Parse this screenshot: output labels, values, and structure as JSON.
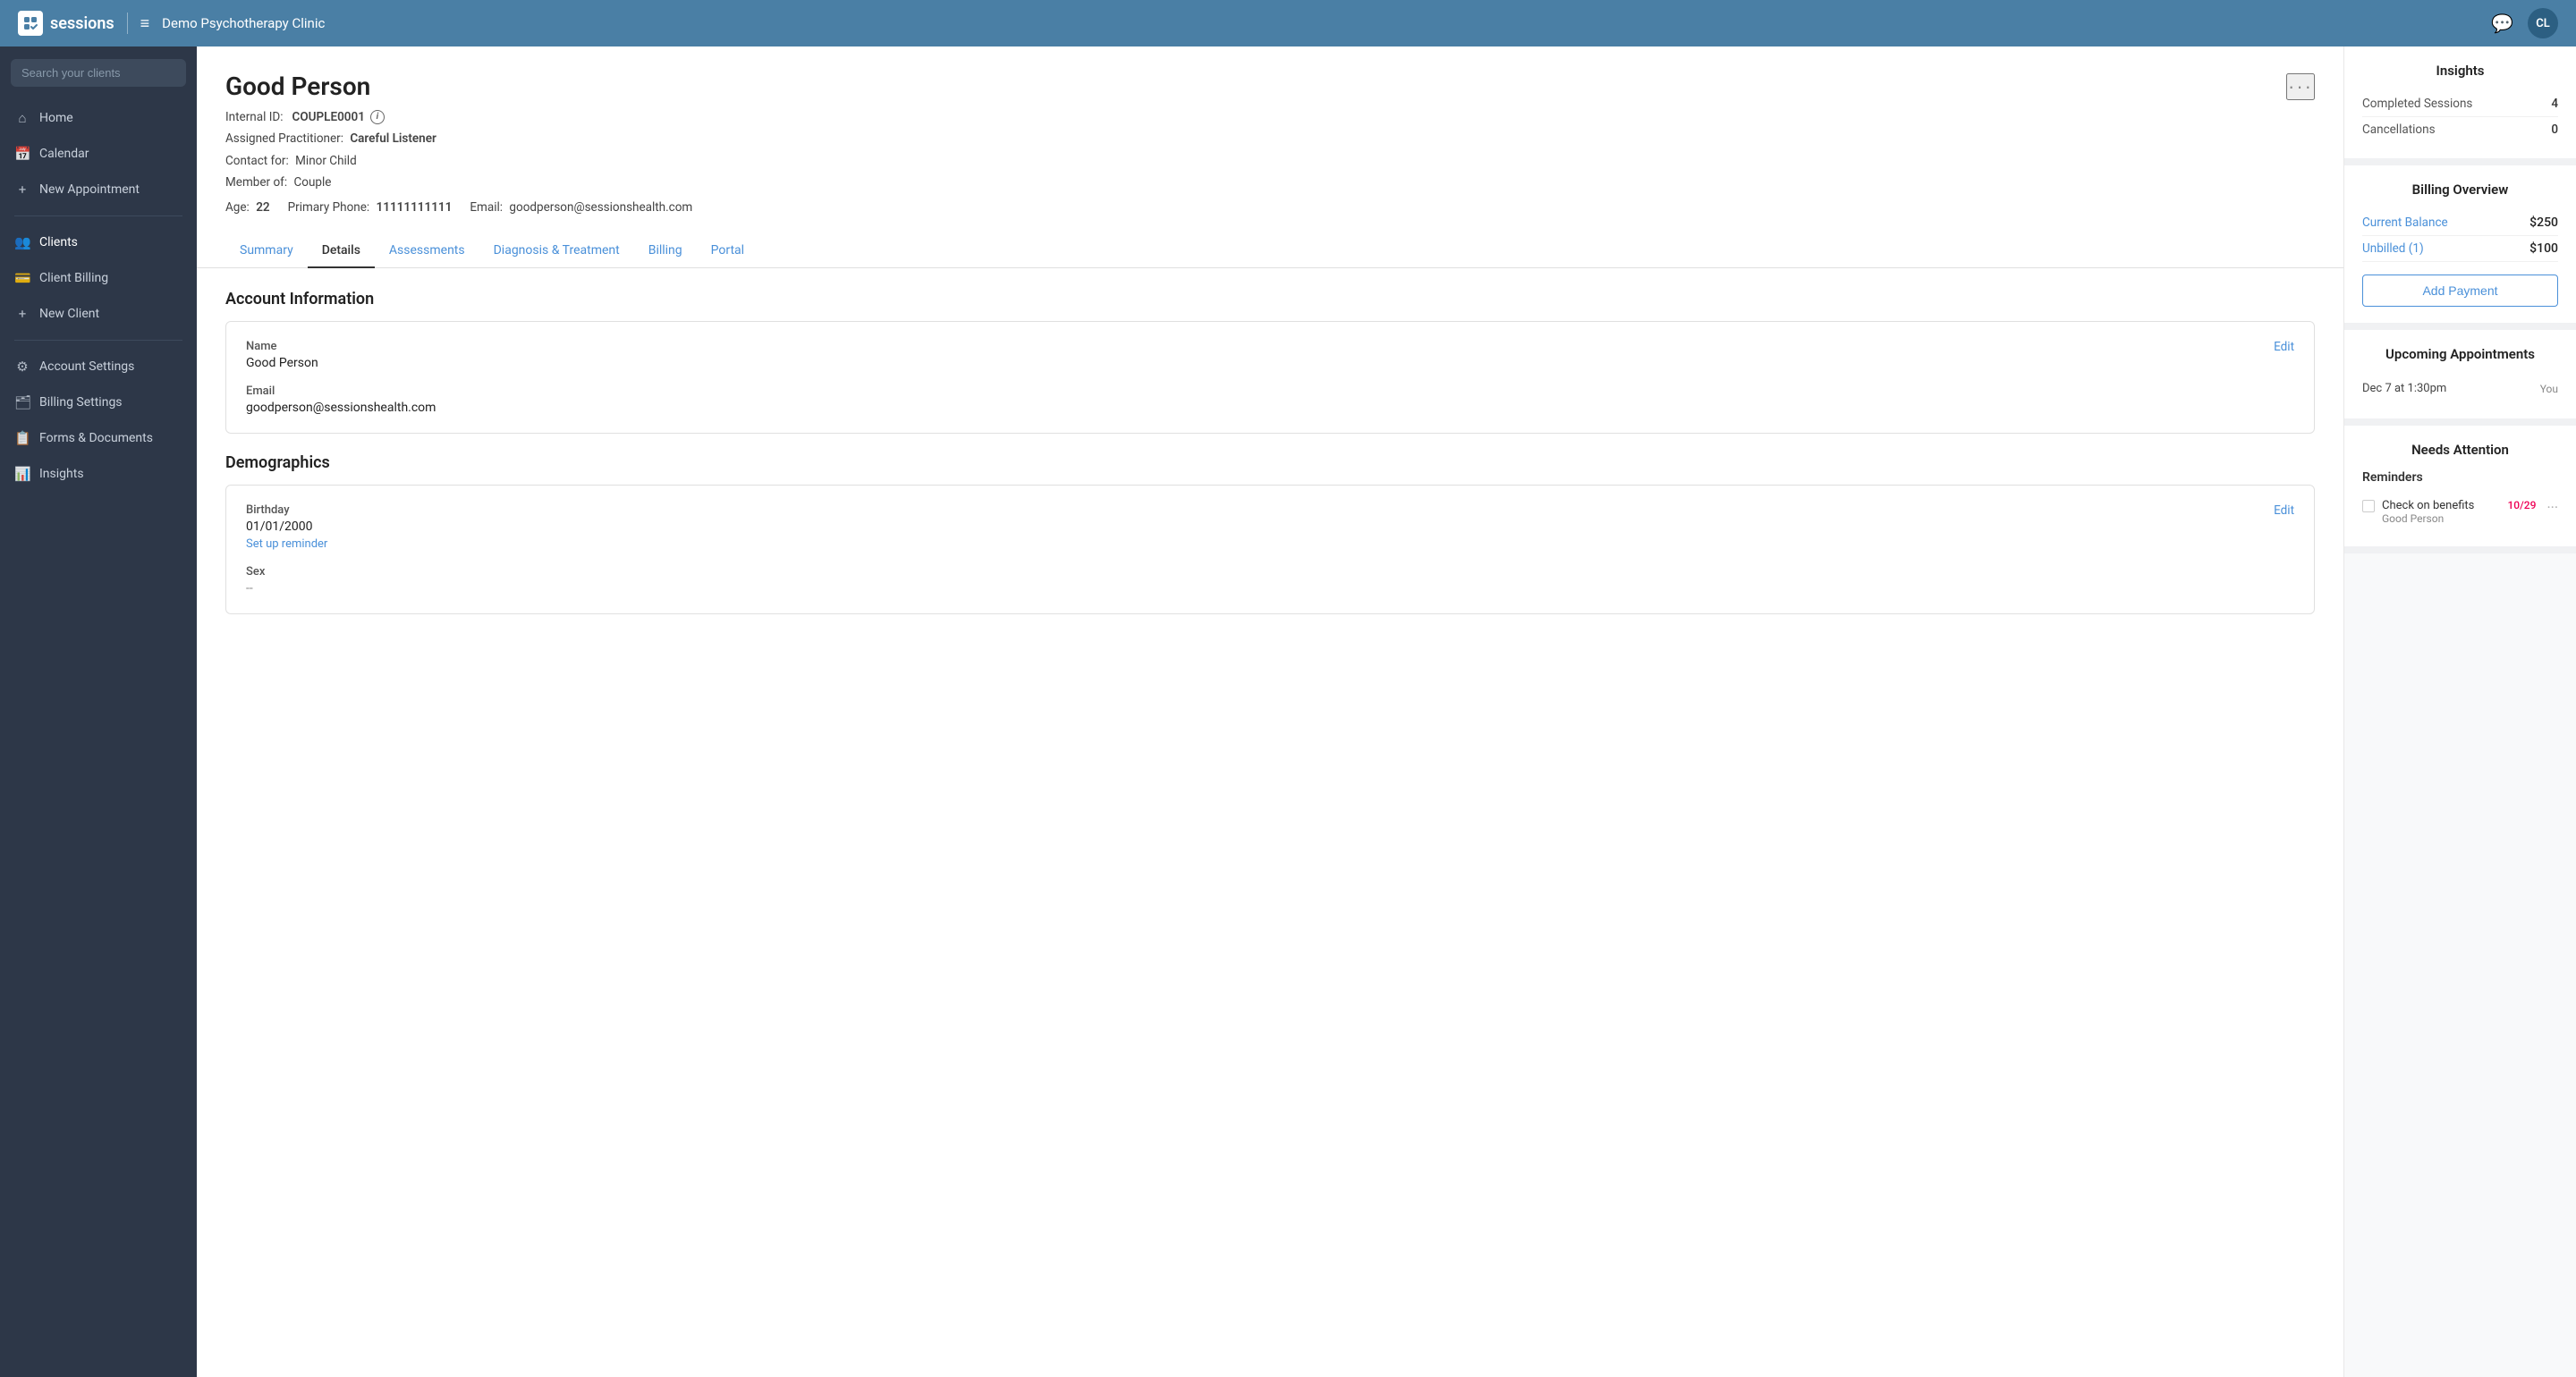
{
  "topnav": {
    "menu_icon": "≡",
    "clinic_name": "Demo Psychotherapy Clinic",
    "chat_icon": "💬",
    "avatar_label": "CL"
  },
  "sidebar": {
    "search_placeholder": "Search your clients",
    "items": [
      {
        "id": "home",
        "label": "Home",
        "icon": "⌂"
      },
      {
        "id": "calendar",
        "label": "Calendar",
        "icon": "📅"
      },
      {
        "id": "new-appointment",
        "label": "New Appointment",
        "icon": "+"
      },
      {
        "id": "clients",
        "label": "Clients",
        "icon": "👥"
      },
      {
        "id": "client-billing",
        "label": "Client Billing",
        "icon": "💳"
      },
      {
        "id": "new-client",
        "label": "New Client",
        "icon": "+"
      },
      {
        "id": "account-settings",
        "label": "Account Settings",
        "icon": "⚙"
      },
      {
        "id": "billing-settings",
        "label": "Billing Settings",
        "icon": "🗂"
      },
      {
        "id": "forms-documents",
        "label": "Forms & Documents",
        "icon": "📋"
      },
      {
        "id": "insights",
        "label": "Insights",
        "icon": "📊"
      }
    ]
  },
  "client": {
    "name": "Good Person",
    "internal_id_label": "Internal ID:",
    "internal_id": "COUPLE0001",
    "practitioner_label": "Assigned Practitioner:",
    "practitioner": "Careful Listener",
    "contact_label": "Contact for:",
    "contact": "Minor Child",
    "member_label": "Member of:",
    "member": "Couple",
    "age_label": "Age:",
    "age": "22",
    "phone_label": "Primary Phone:",
    "phone": "11111111111",
    "email_label": "Email:",
    "email": "goodperson@sessionshealth.com"
  },
  "tabs": [
    {
      "id": "summary",
      "label": "Summary"
    },
    {
      "id": "details",
      "label": "Details",
      "active": true
    },
    {
      "id": "assessments",
      "label": "Assessments"
    },
    {
      "id": "diagnosis",
      "label": "Diagnosis & Treatment"
    },
    {
      "id": "billing",
      "label": "Billing"
    },
    {
      "id": "portal",
      "label": "Portal"
    }
  ],
  "account_info": {
    "section_title": "Account Information",
    "name_label": "Name",
    "name_value": "Good Person",
    "email_label": "Email",
    "email_value": "goodperson@sessionshealth.com",
    "edit_label": "Edit"
  },
  "demographics": {
    "section_title": "Demographics",
    "birthday_label": "Birthday",
    "birthday_value": "01/01/2000",
    "setup_reminder_label": "Set up reminder",
    "sex_label": "Sex",
    "sex_value": "--",
    "edit_label": "Edit"
  },
  "right_panel": {
    "insights": {
      "title": "Insights",
      "completed_sessions_label": "Completed Sessions",
      "completed_sessions_value": "4",
      "cancellations_label": "Cancellations",
      "cancellations_value": "0"
    },
    "billing": {
      "title": "Billing Overview",
      "current_balance_label": "Current Balance",
      "current_balance_value": "$250",
      "unbilled_label": "Unbilled (1)",
      "unbilled_value": "$100",
      "add_payment_label": "Add Payment"
    },
    "upcoming": {
      "title": "Upcoming Appointments",
      "appointments": [
        {
          "date": "Dec 7 at 1:30pm",
          "who": "You"
        }
      ]
    },
    "needs_attention": {
      "title": "Needs Attention",
      "reminders_title": "Reminders",
      "reminders": [
        {
          "label": "Check on benefits",
          "date": "10/29",
          "client": "Good Person"
        }
      ]
    }
  }
}
